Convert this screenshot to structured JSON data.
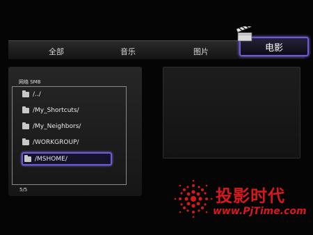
{
  "tabs": [
    {
      "label": "全部"
    },
    {
      "label": "音乐"
    },
    {
      "label": "图片"
    },
    {
      "label": "电影",
      "active": true
    }
  ],
  "browser": {
    "source_label": "网络 SMB",
    "items": [
      {
        "label": "/../"
      },
      {
        "label": "/My_Shortcuts/"
      },
      {
        "label": "/My_Neighbors/"
      },
      {
        "label": "/WORKGROUP/"
      },
      {
        "label": "/MSHOME/",
        "selected": true
      }
    ],
    "page_count": "5/5"
  },
  "watermark": {
    "chinese": "投影时代",
    "english": "www.PjTime.com"
  },
  "colors": {
    "accent": "#6d5ad8",
    "watermark": "#d8191c"
  },
  "icons": {
    "active_tab": "clapperboard-icon",
    "item": "folder-icon",
    "watermark": "sunburst-logo-icon"
  }
}
